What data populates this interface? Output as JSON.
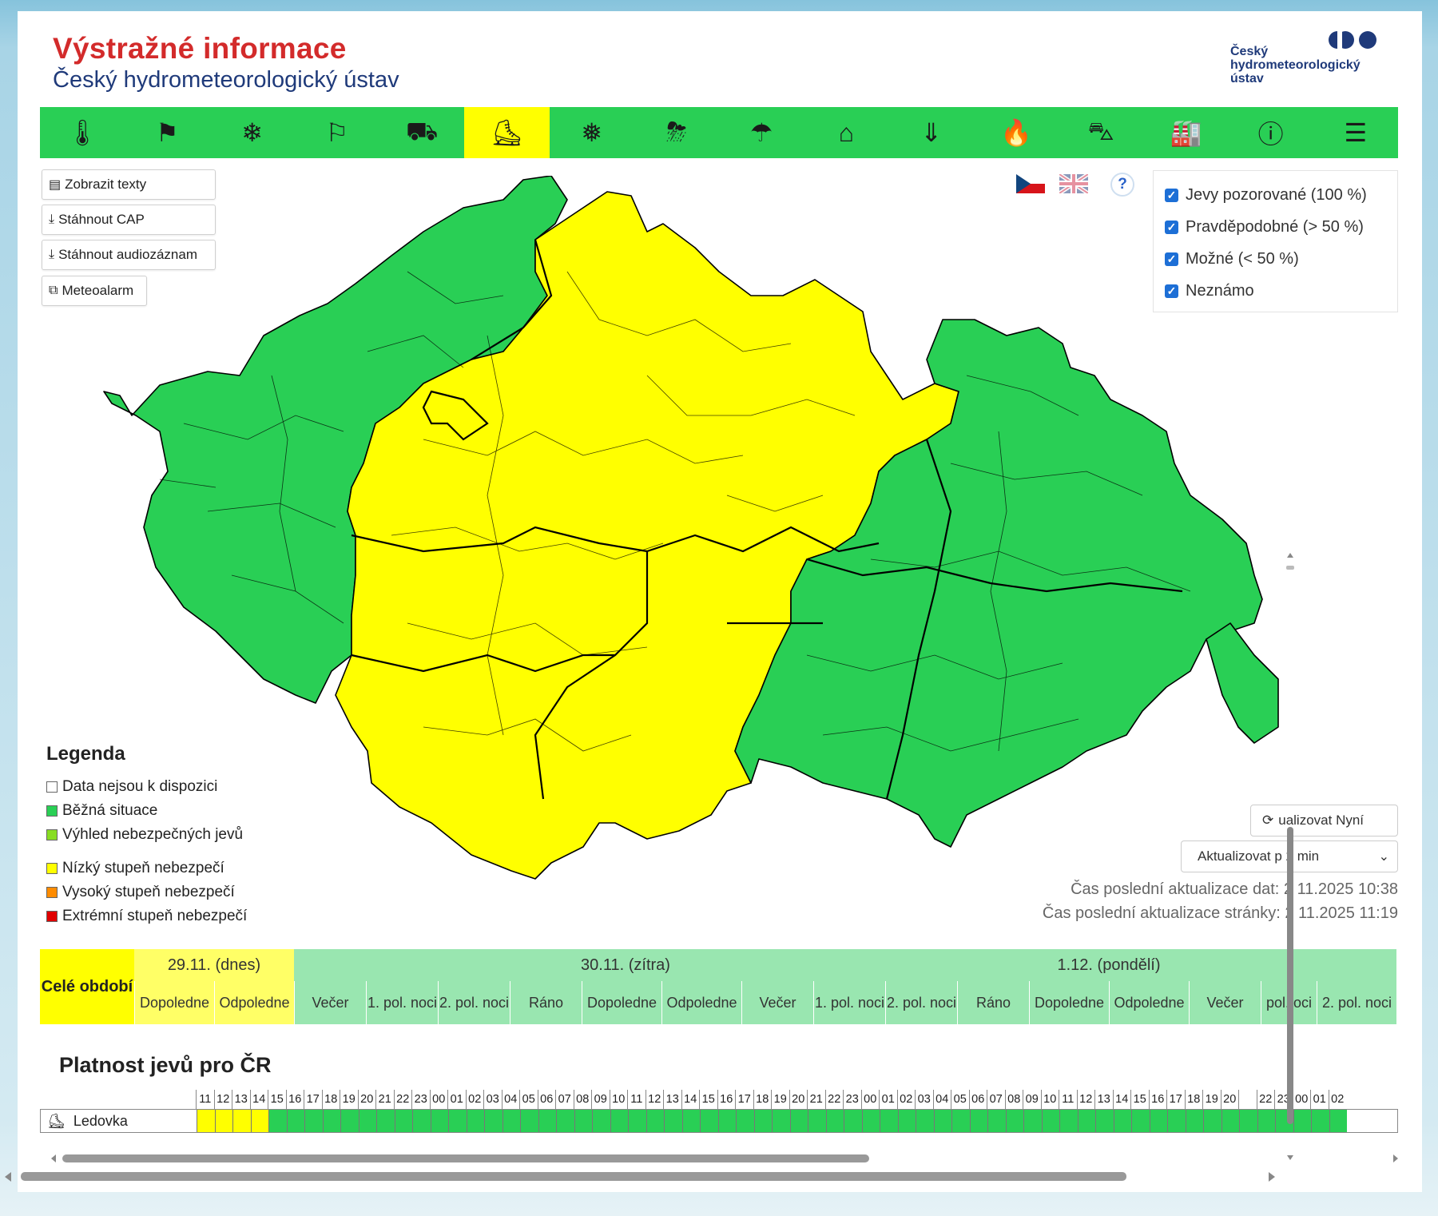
{
  "header": {
    "title": "Výstražné informace",
    "subtitle": "Český hydrometeorologický ústav",
    "logo_line1": "Český",
    "logo_line2": "hydrometeorologický",
    "logo_line3": "ústav"
  },
  "icons": [
    {
      "name": "temperature-icon",
      "glyph": "🌡"
    },
    {
      "name": "wind-icon",
      "glyph": "⚑"
    },
    {
      "name": "snow-icon",
      "glyph": "❄"
    },
    {
      "name": "snow-wind-icon",
      "glyph": "⚐"
    },
    {
      "name": "road-ice-icon",
      "glyph": "⛟"
    },
    {
      "name": "glaze-ice-icon",
      "glyph": "⛸"
    },
    {
      "name": "frost-icon",
      "glyph": "❅"
    },
    {
      "name": "thunderstorm-icon",
      "glyph": "⛈"
    },
    {
      "name": "rain-icon",
      "glyph": "☂"
    },
    {
      "name": "flood-icon",
      "glyph": "⌂"
    },
    {
      "name": "water-level-icon",
      "glyph": "⇓"
    },
    {
      "name": "fire-icon",
      "glyph": "🔥"
    },
    {
      "name": "fog-traffic-icon",
      "glyph": "⛍"
    },
    {
      "name": "smog-icon",
      "glyph": "🏭"
    },
    {
      "name": "warning-icon",
      "glyph": "ⓘ"
    },
    {
      "name": "list-icon",
      "glyph": "☰"
    }
  ],
  "active_icon": 5,
  "buttons": {
    "texts": "Zobrazit texty",
    "cap": "Stáhnout CAP",
    "audio": "Stáhnout audiozáznam",
    "meteoalarm": "Meteoalarm"
  },
  "help": "?",
  "checks": [
    "Jevy pozorované (100 %)",
    "Pravděpodobné (> 50 %)",
    "Možné (< 50 %)",
    "Neznámo"
  ],
  "legend": {
    "title": "Legenda",
    "items": [
      {
        "label": "Data nejsou k dispozici",
        "color": "#ffffff"
      },
      {
        "label": "Běžná situace",
        "color": "#29cf55"
      },
      {
        "label": "Výhled nebezpečných jevů",
        "color": "#88dd22"
      },
      {
        "label": "Nízký stupeň nebezpečí",
        "color": "#ffff00"
      },
      {
        "label": "Vysoký stupeň nebezpečí",
        "color": "#ff8c00"
      },
      {
        "label": "Extrémní stupeň nebezpečí",
        "color": "#e00000"
      }
    ]
  },
  "update": {
    "button": "ualizovat Nyní",
    "select": "Aktualizovat p 2 min",
    "data_time": "Čas poslední aktualizace dat: 2 11.2025 10:38",
    "page_time": "Čas poslední aktualizace stránky: 2 11.2025 11:19"
  },
  "timeline": {
    "whole": "Celé období",
    "days": [
      {
        "label": "29.11. (dnes)",
        "color": "#ffff66"
      },
      {
        "label": "30.11. (zítra)",
        "color": "#99e6b0"
      },
      {
        "label": "1.12. (pondělí)",
        "color": "#99e6b0"
      },
      {
        "label": "",
        "color": "#99e6b0"
      }
    ],
    "slots": [
      {
        "label": "Dopoledne",
        "color": "#ffff66"
      },
      {
        "label": "Odpoledne",
        "color": "#ffff66"
      },
      {
        "label": "Večer",
        "color": "#99e6b0"
      },
      {
        "label": "1. pol. noci",
        "color": "#99e6b0"
      },
      {
        "label": "2. pol. noci",
        "color": "#99e6b0"
      },
      {
        "label": "Ráno",
        "color": "#99e6b0"
      },
      {
        "label": "Dopoledne",
        "color": "#99e6b0"
      },
      {
        "label": "Odpoledne",
        "color": "#99e6b0"
      },
      {
        "label": "Večer",
        "color": "#99e6b0"
      },
      {
        "label": "1. pol. noci",
        "color": "#99e6b0"
      },
      {
        "label": "2. pol. noci",
        "color": "#99e6b0"
      },
      {
        "label": "Ráno",
        "color": "#99e6b0"
      },
      {
        "label": "Dopoledne",
        "color": "#99e6b0"
      },
      {
        "label": "Odpoledne",
        "color": "#99e6b0"
      },
      {
        "label": "Večer",
        "color": "#99e6b0"
      },
      {
        "label": "pol. oci",
        "color": "#99e6b0"
      },
      {
        "label": "2. pol. noci",
        "color": "#99e6b0"
      }
    ]
  },
  "platnost": {
    "title": "Platnost jevů pro ČR",
    "row_label": "Ledovka",
    "hours": [
      "11",
      "12",
      "13",
      "14",
      "15",
      "16",
      "17",
      "18",
      "19",
      "20",
      "21",
      "22",
      "23",
      "00",
      "01",
      "02",
      "03",
      "04",
      "05",
      "06",
      "07",
      "08",
      "09",
      "10",
      "11",
      "12",
      "13",
      "14",
      "15",
      "16",
      "17",
      "18",
      "19",
      "20",
      "21",
      "22",
      "23",
      "00",
      "01",
      "02",
      "03",
      "04",
      "05",
      "06",
      "07",
      "08",
      "09",
      "10",
      "11",
      "12",
      "13",
      "14",
      "15",
      "16",
      "17",
      "18",
      "19",
      "20",
      "",
      "22",
      "23",
      "00",
      "01",
      "02"
    ],
    "yellow_count": 4
  }
}
